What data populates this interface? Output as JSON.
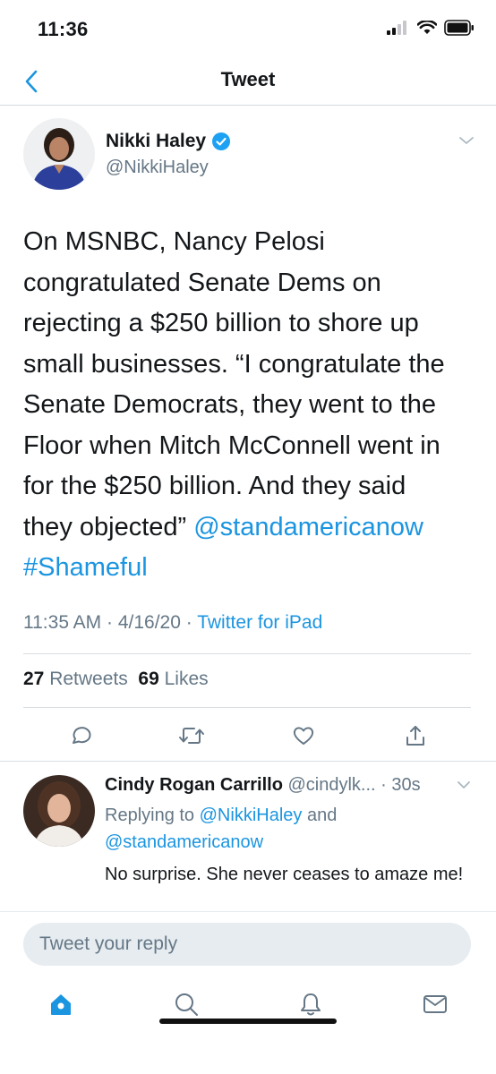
{
  "status_bar": {
    "time": "11:36"
  },
  "header": {
    "title": "Tweet"
  },
  "tweet": {
    "author_name": "Nikki Haley",
    "author_handle": "@NikkiHaley",
    "text_lines": [
      "On MSNBC, Nancy Pelosi",
      "congratulated Senate Dems on",
      "rejecting a $250 billion to shore up",
      "small businesses. “I congratulate the",
      "Senate Democrats, they went to the",
      "Floor when Mitch McConnell went in",
      "for the $250 billion. And they said",
      "they objected”"
    ],
    "mention": "@standamericanow",
    "hashtag": "#Shameful",
    "time": "11:35 AM",
    "date": "4/16/20",
    "source": "Twitter for iPad",
    "retweet_count": "27",
    "retweet_label": "Retweets",
    "like_count": "69",
    "like_label": "Likes"
  },
  "reply": {
    "name": "Cindy Rogan Carrillo",
    "handle": "@cindylk...",
    "time": "30s",
    "replying_prefix": "Replying to",
    "replying_to_1": "@NikkiHaley",
    "replying_and": "and",
    "replying_to_2": "@standamericanow",
    "text": "No surprise. She never ceases to amaze me!"
  },
  "compose": {
    "placeholder": "Tweet your reply"
  },
  "colors": {
    "accent": "#1b95e0",
    "text": "#14171a",
    "secondary": "#657786"
  },
  "icons": {
    "header": [
      "back-chevron-icon"
    ],
    "actions": [
      "reply-icon",
      "retweet-icon",
      "like-icon",
      "share-icon"
    ],
    "tabs": [
      "home-icon",
      "search-icon",
      "notifications-icon",
      "messages-icon"
    ]
  }
}
